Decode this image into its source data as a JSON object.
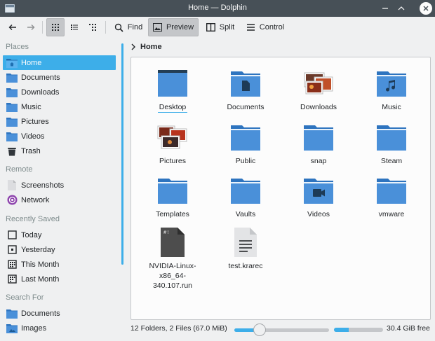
{
  "window": {
    "title": "Home — Dolphin"
  },
  "toolbar": {
    "find": "Find",
    "preview": "Preview",
    "split": "Split",
    "control": "Control"
  },
  "sidebar": {
    "places_header": "Places",
    "places": [
      {
        "label": "Home",
        "icon": "home-folder-icon"
      },
      {
        "label": "Documents",
        "icon": "folder-icon"
      },
      {
        "label": "Downloads",
        "icon": "folder-icon"
      },
      {
        "label": "Music",
        "icon": "folder-icon"
      },
      {
        "label": "Pictures",
        "icon": "folder-icon"
      },
      {
        "label": "Videos",
        "icon": "folder-icon"
      },
      {
        "label": "Trash",
        "icon": "trash-icon"
      }
    ],
    "remote_header": "Remote",
    "remote": [
      {
        "label": "Screenshots",
        "icon": "document-icon"
      },
      {
        "label": "Network",
        "icon": "network-icon"
      }
    ],
    "recent_header": "Recently Saved",
    "recent": [
      {
        "label": "Today",
        "icon": "calendar-today-icon"
      },
      {
        "label": "Yesterday",
        "icon": "calendar-yesterday-icon"
      },
      {
        "label": "This Month",
        "icon": "calendar-month-icon"
      },
      {
        "label": "Last Month",
        "icon": "calendar-last-month-icon"
      }
    ],
    "search_header": "Search For",
    "search": [
      {
        "label": "Documents",
        "icon": "folder-icon"
      },
      {
        "label": "Images",
        "icon": "folder-images-icon"
      }
    ]
  },
  "breadcrumb": {
    "current": "Home"
  },
  "files": [
    {
      "name": "Desktop",
      "kind": "desktop-folder"
    },
    {
      "name": "Documents",
      "kind": "documents-folder"
    },
    {
      "name": "Downloads",
      "kind": "photos-preview"
    },
    {
      "name": "Music",
      "kind": "music-folder"
    },
    {
      "name": "Pictures",
      "kind": "photos-preview"
    },
    {
      "name": "Public",
      "kind": "folder"
    },
    {
      "name": "snap",
      "kind": "folder"
    },
    {
      "name": "Steam",
      "kind": "folder"
    },
    {
      "name": "Templates",
      "kind": "folder"
    },
    {
      "name": "Vaults",
      "kind": "folder"
    },
    {
      "name": "Videos",
      "kind": "videos-folder"
    },
    {
      "name": "vmware",
      "kind": "folder"
    },
    {
      "name": "NVIDIA-Linux-x86_64-340.107.run",
      "kind": "script-file"
    },
    {
      "name": "test.krarec",
      "kind": "text-file"
    }
  ],
  "status": {
    "summary": "12 Folders, 2 Files (67.0 MiB)",
    "zoom_fraction": 0.25,
    "disk_used_fraction": 0.3,
    "free_space": "30.4 GiB free"
  },
  "colors": {
    "accent": "#3daee9",
    "folder": "#4a90d9",
    "titlebar": "#475057"
  }
}
